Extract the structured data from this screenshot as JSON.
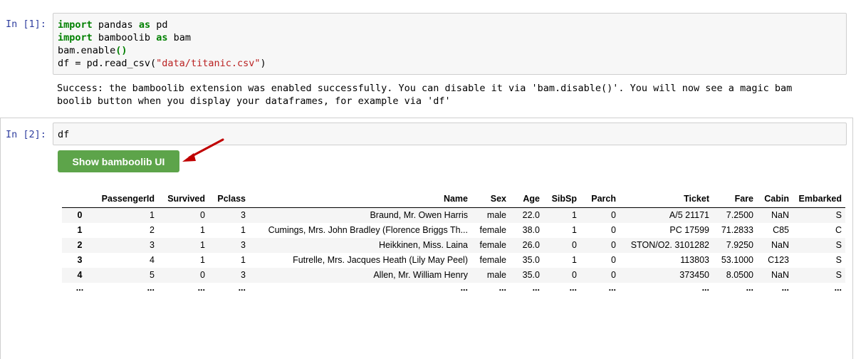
{
  "cell1": {
    "prompt": "In [1]:",
    "code": [
      [
        {
          "t": "import",
          "c": "kw"
        },
        {
          "t": " pandas ",
          "c": ""
        },
        {
          "t": "as",
          "c": "kw"
        },
        {
          "t": " pd",
          "c": ""
        }
      ],
      [
        {
          "t": "import",
          "c": "kw"
        },
        {
          "t": " bamboolib ",
          "c": ""
        },
        {
          "t": "as",
          "c": "kw"
        },
        {
          "t": " bam",
          "c": ""
        }
      ],
      [
        {
          "t": "bam.enable",
          "c": ""
        },
        {
          "t": "()",
          "c": "kw"
        }
      ],
      [
        {
          "t": "df = pd.read_csv(",
          "c": ""
        },
        {
          "t": "\"data/titanic.csv\"",
          "c": "str"
        },
        {
          "t": ")",
          "c": ""
        }
      ]
    ],
    "output_lines": [
      "Success: the bamboolib extension was enabled successfully. You can disable it via 'bam.disable()'. You will now see a magic bam",
      "boolib button when you display your dataframes, for example via 'df'"
    ]
  },
  "cell2": {
    "prompt": "In [2]:",
    "code": "df",
    "button_label": "Show bamboolib UI"
  },
  "colors": {
    "prompt": "#303f9f",
    "keyword": "#008000",
    "string": "#ba2121",
    "button": "#5da44a",
    "arrow": "#c00000"
  },
  "table": {
    "columns": [
      "",
      "PassengerId",
      "Survived",
      "Pclass",
      "Name",
      "Sex",
      "Age",
      "SibSp",
      "Parch",
      "Ticket",
      "Fare",
      "Cabin",
      "Embarked"
    ],
    "rows": [
      [
        "0",
        "1",
        "0",
        "3",
        "Braund, Mr. Owen Harris",
        "male",
        "22.0",
        "1",
        "0",
        "A/5 21171",
        "7.2500",
        "NaN",
        "S"
      ],
      [
        "1",
        "2",
        "1",
        "1",
        "Cumings, Mrs. John Bradley (Florence Briggs Th...",
        "female",
        "38.0",
        "1",
        "0",
        "PC 17599",
        "71.2833",
        "C85",
        "C"
      ],
      [
        "2",
        "3",
        "1",
        "3",
        "Heikkinen, Miss. Laina",
        "female",
        "26.0",
        "0",
        "0",
        "STON/O2. 3101282",
        "7.9250",
        "NaN",
        "S"
      ],
      [
        "3",
        "4",
        "1",
        "1",
        "Futrelle, Mrs. Jacques Heath (Lily May Peel)",
        "female",
        "35.0",
        "1",
        "0",
        "113803",
        "53.1000",
        "C123",
        "S"
      ],
      [
        "4",
        "5",
        "0",
        "3",
        "Allen, Mr. William Henry",
        "male",
        "35.0",
        "0",
        "0",
        "373450",
        "8.0500",
        "NaN",
        "S"
      ]
    ],
    "ellipsis_row": [
      "...",
      "...",
      "...",
      "...",
      "...",
      "...",
      "...",
      "...",
      "...",
      "...",
      "...",
      "...",
      "..."
    ]
  }
}
